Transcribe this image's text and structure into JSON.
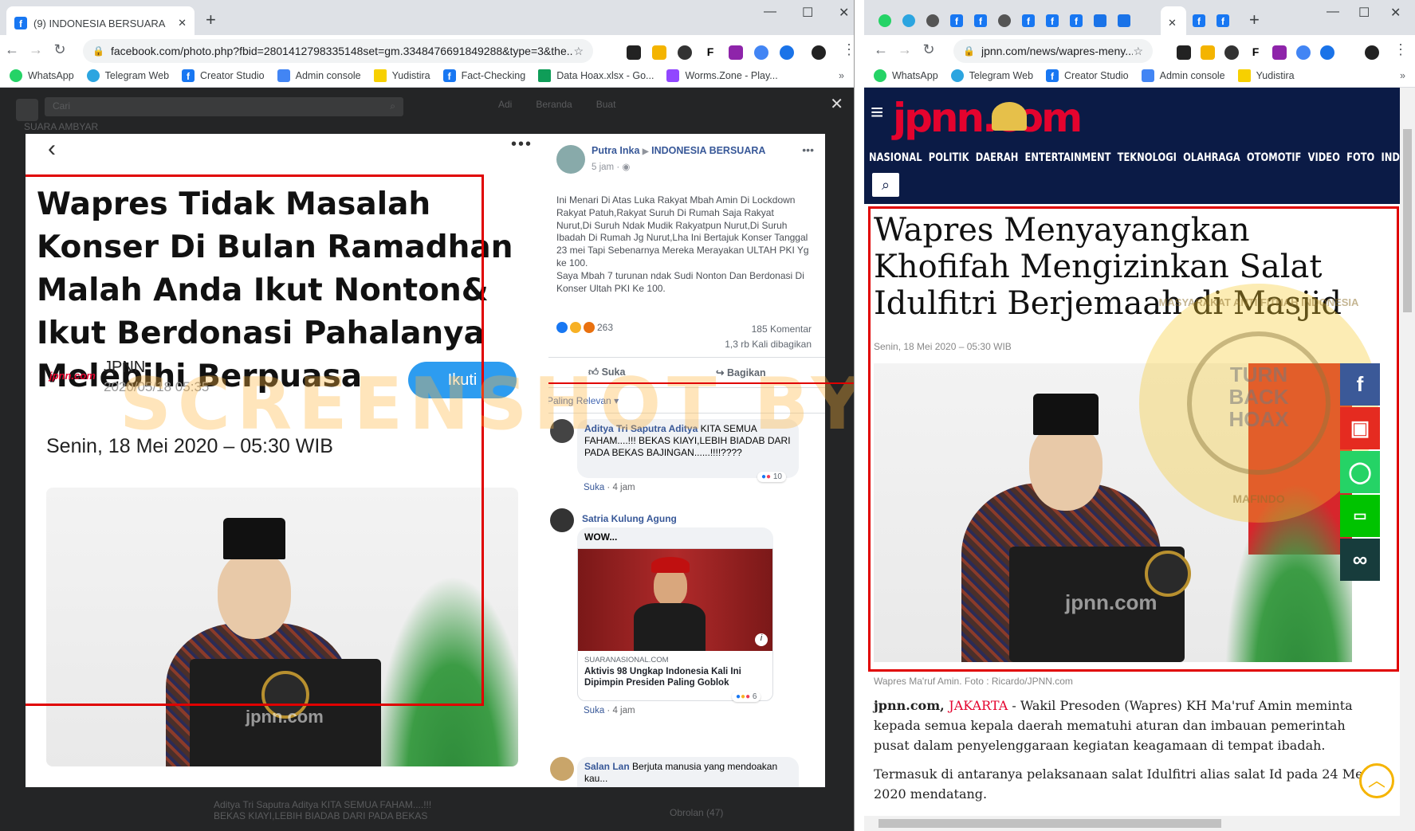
{
  "left_window": {
    "tab_title": "(9) INDONESIA BERSUARA",
    "url": "facebook.com/photo.php?fbid=2801412798335148set=gm.3348476691849288&type=3&the...",
    "bookmarks": [
      "WhatsApp",
      "Telegram Web",
      "Creator Studio",
      "Admin console",
      "Yudistira",
      "Fact-Checking",
      "Data Hoax.xlsx - Go...",
      "Worms.Zone - Play..."
    ],
    "fb_search_placeholder": "Cari",
    "fb_nav": [
      "Adi",
      "Beranda",
      "Buat"
    ],
    "fb_group_partial": "SUARA AMBYAR",
    "bottom_chat": "Obrolan (47)",
    "bottom_preview_name": "Aditya Tri Saputra Aditya KITA SEMUA FAHAM....!!!",
    "bottom_preview_text": "BEKAS KIAYI,LEBIH BIADAB DARI PADA BEKAS"
  },
  "meme": {
    "title": "Wapres Tidak Masalah Konser Di Bulan Ramadhan Malah Anda Ikut Nonton& Ikut Berdonasi Pahalanya Melebihi Berpuasa",
    "source": "JPNN",
    "logo": "jpnn.com",
    "timestamp": "2020/05/18 05:35",
    "follow_button": "Ikuti",
    "date": "Senin, 18 Mei 2020 – 05:30 WIB",
    "photo_watermark": "jpnn.com"
  },
  "post": {
    "author": "Putra Inka",
    "group": "INDONESIA BERSUARA",
    "time": "5 jam",
    "text": "Ini Menari Di Atas Luka Rakyat Mbah Amin Di Lockdown Rakyat Patuh,Rakyat Suruh Di Rumah Saja Rakyat Nurut,Di Suruh Ndak Mudik Rakyatpun Nurut,Di Suruh Ibadah Di Rumah Jg Nurut,Lha Ini Bertajuk Konser Tanggal 23 mei Tapi Sebenarnya Mereka Merayakan ULTAH PKI Yg ke 100.",
    "text2": "Saya Mbah 7 turunan ndak Sudi Nonton Dan Berdonasi Di Konser Ultah PKI Ke 100.",
    "reactions": "263",
    "comments": "185 Komentar",
    "shares": "1,3 rb Kali dibagikan",
    "like": "Suka",
    "share": "Bagikan",
    "sort": "Paling Relevan"
  },
  "comments": [
    {
      "name": "Aditya Tri Saputra Aditya",
      "text": "KITA SEMUA FAHAM....!!! BEKAS KIAYI,LEBIH BIADAB DARI PADA BEKAS BAJINGAN......!!!!????",
      "like": "Suka",
      "time": "4 jam",
      "reacts": "10"
    },
    {
      "name": "Satria Kulung Agung",
      "text": "WOW...",
      "link_domain": "SUARANASIONAL.COM",
      "link_title": "Aktivis 98 Ungkap Indonesia Kali Ini Dipimpin Presiden Paling Goblok",
      "like": "Suka",
      "time": "4 jam",
      "reacts": "6"
    },
    {
      "name": "Salan Lan",
      "text": "Berjuta manusia yang mendoakan kau..."
    }
  ],
  "right_window": {
    "url": "jpnn.com/news/wapres-meny...",
    "bookmarks": [
      "WhatsApp",
      "Telegram Web",
      "Creator Studio",
      "Admin console",
      "Yudistira"
    ],
    "logo": "jpnn.com",
    "menu": [
      "NASIONAL",
      "POLITIK",
      "DAERAH",
      "ENTERTAINMENT",
      "TEKNOLOGI",
      "OLAHRAGA",
      "OTOMOTIF",
      "VIDEO",
      "FOTO",
      "INDEKS"
    ],
    "headline": "Wapres Menyayangkan Khofifah Mengizinkan Salat Idulfitri Berjemaah di Masjid",
    "date": "Senin, 18 Mei 2020 – 05:30 WIB",
    "caption": "Wapres Ma'ruf Amin. Foto : Ricardo/JPNN.com",
    "lead_site": "jpnn.com, ",
    "lead_city": "JAKARTA",
    "lead_text": " - Wakil Presoden (Wapres) KH Ma'ruf Amin meminta kepada semua kepala daerah mematuhi aturan dan imbauan pemerintah pusat dalam penyelenggaraan kegiatan keagamaan di tempat ibadah.",
    "para2": "Termasuk di antaranya pelaksanaan salat Idulfitri alias salat Id pada 24 Mei 2020 mendatang.",
    "badge_text": "TURN BACK HOAX",
    "badge_ring": "MASYARAKAT ANTI FITNAH INDONESIA",
    "badge_bottom": "MAFINDO",
    "photo_watermark": "jpnn.com"
  },
  "screenshot_watermark": "SCREENSHOT BY",
  "colors": {
    "fb_blue": "#1877f2",
    "jpnn_navy": "#0b1b46",
    "jpnn_red": "#e4032e",
    "highlight_red": "#e00000"
  }
}
